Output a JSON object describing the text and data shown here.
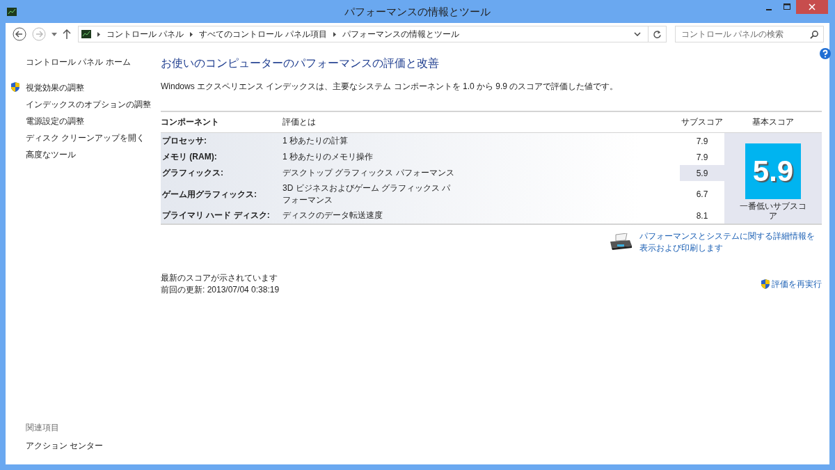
{
  "window": {
    "title": "パフォーマンスの情報とツール"
  },
  "address_bar": {
    "crumbs": [
      "コントロール パネル",
      "すべてのコントロール パネル項目",
      "パフォーマンスの情報とツール"
    ]
  },
  "search": {
    "placeholder": "コントロール パネルの検索"
  },
  "sidebar": {
    "home": "コントロール パネル ホーム",
    "items": [
      {
        "label": "視覚効果の調整",
        "shield": true
      },
      {
        "label": "インデックスのオプションの調整",
        "shield": false
      },
      {
        "label": "電源設定の調整",
        "shield": false
      },
      {
        "label": "ディスク クリーンアップを開く",
        "shield": false
      },
      {
        "label": "高度なツール",
        "shield": false
      }
    ],
    "related_heading": "関連項目",
    "related": [
      "アクション センター"
    ]
  },
  "heading": "お使いのコンピューターのパフォーマンスの評価と改善",
  "intro": "Windows エクスペリエンス インデックスは、主要なシステム コンポーネントを 1.0 から 9.9 のスコアで評価した値です。",
  "table": {
    "columns": [
      "コンポーネント",
      "評価とは",
      "サブスコア",
      "基本スコア"
    ],
    "rows": [
      {
        "component": "プロセッサ:",
        "rating": "1 秒あたりの計算",
        "subscore": "7.9",
        "lowest": false
      },
      {
        "component": "メモリ (RAM):",
        "rating": "1 秒あたりのメモリ操作",
        "subscore": "7.9",
        "lowest": false
      },
      {
        "component": "グラフィックス:",
        "rating": "デスクトップ グラフィックス パフォーマンス",
        "subscore": "5.9",
        "lowest": true
      },
      {
        "component": "ゲーム用グラフィックス:",
        "rating": "3D ビジネスおよびゲーム グラフィックス パフォーマンス",
        "subscore": "6.7",
        "lowest": false
      },
      {
        "component": "プライマリ ハード ディスク:",
        "rating": "ディスクのデータ転送速度",
        "subscore": "8.1",
        "lowest": false
      }
    ],
    "base_score": "5.9",
    "base_caption": "一番低いサブスコア"
  },
  "details_link": "パフォーマンスとシステムに関する詳細情報を表示および印刷します",
  "status": [
    "最新のスコアが示されています",
    "前回の更新: 2013/07/04 0:38:19"
  ],
  "rerun_link": "評価を再実行"
}
